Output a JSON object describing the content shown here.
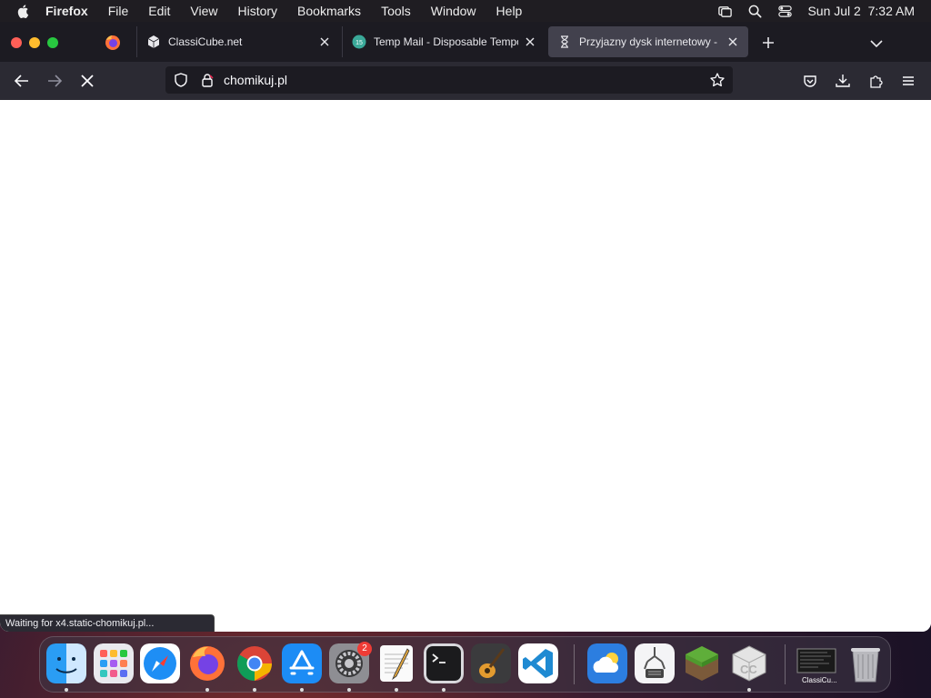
{
  "menubar": {
    "app": "Firefox",
    "items": [
      "File",
      "Edit",
      "View",
      "History",
      "Bookmarks",
      "Tools",
      "Window",
      "Help"
    ],
    "datetime": "Sun Jul 2  7:32 AM"
  },
  "tabs": [
    {
      "title": "ClassiCube.net",
      "icon": "classicube-icon"
    },
    {
      "title": "Temp Mail - Disposable Tempor",
      "icon": "tempmail-icon",
      "badge": "15"
    },
    {
      "title": "Przyjazny dysk internetowy - Ch",
      "icon": "hourglass-icon",
      "active": true
    }
  ],
  "urlbar": {
    "url": "chomikuj.pl"
  },
  "status": "Waiting for x4.static-chomikuj.pl...",
  "dock": {
    "settings_badge": "2",
    "classicube_label": "ClassiCu..."
  },
  "colors": {
    "tabbar": "#1c1b22",
    "navbar": "#2b2a33",
    "active_tab": "#42414d"
  }
}
